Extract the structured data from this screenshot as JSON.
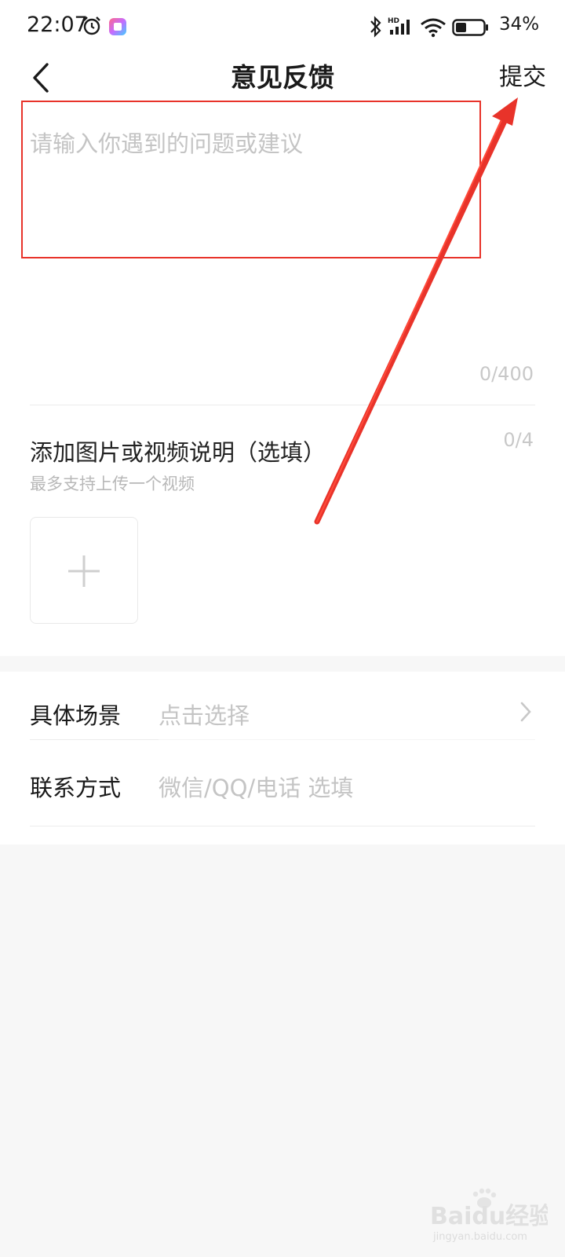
{
  "status_bar": {
    "time": "22:07",
    "battery": "34%",
    "icons": [
      "alarm-icon",
      "app-shortcut-icon",
      "bluetooth-icon",
      "hd-signal-icon",
      "wifi-icon",
      "battery-icon"
    ]
  },
  "header": {
    "title": "意见反馈",
    "submit_label": "提交",
    "back_icon": "chevron-left-icon"
  },
  "feedback": {
    "placeholder": "请输入你遇到的问题或建议",
    "value": "",
    "counter": "0/400"
  },
  "media": {
    "title": "添加图片或视频说明（选填）",
    "counter": "0/4",
    "hint": "最多支持上传一个视频",
    "add_icon": "plus-icon"
  },
  "options": {
    "scene": {
      "label": "具体场景",
      "value": "点击选择"
    },
    "contact": {
      "label": "联系方式",
      "placeholder": "微信/QQ/电话 选填"
    }
  },
  "watermark": {
    "brand": "Baidu经验",
    "url": "jingyan.baidu.com"
  },
  "colors": {
    "annotation": "#e8332a",
    "placeholder": "#c4c4c4",
    "background": "#f7f7f7"
  }
}
